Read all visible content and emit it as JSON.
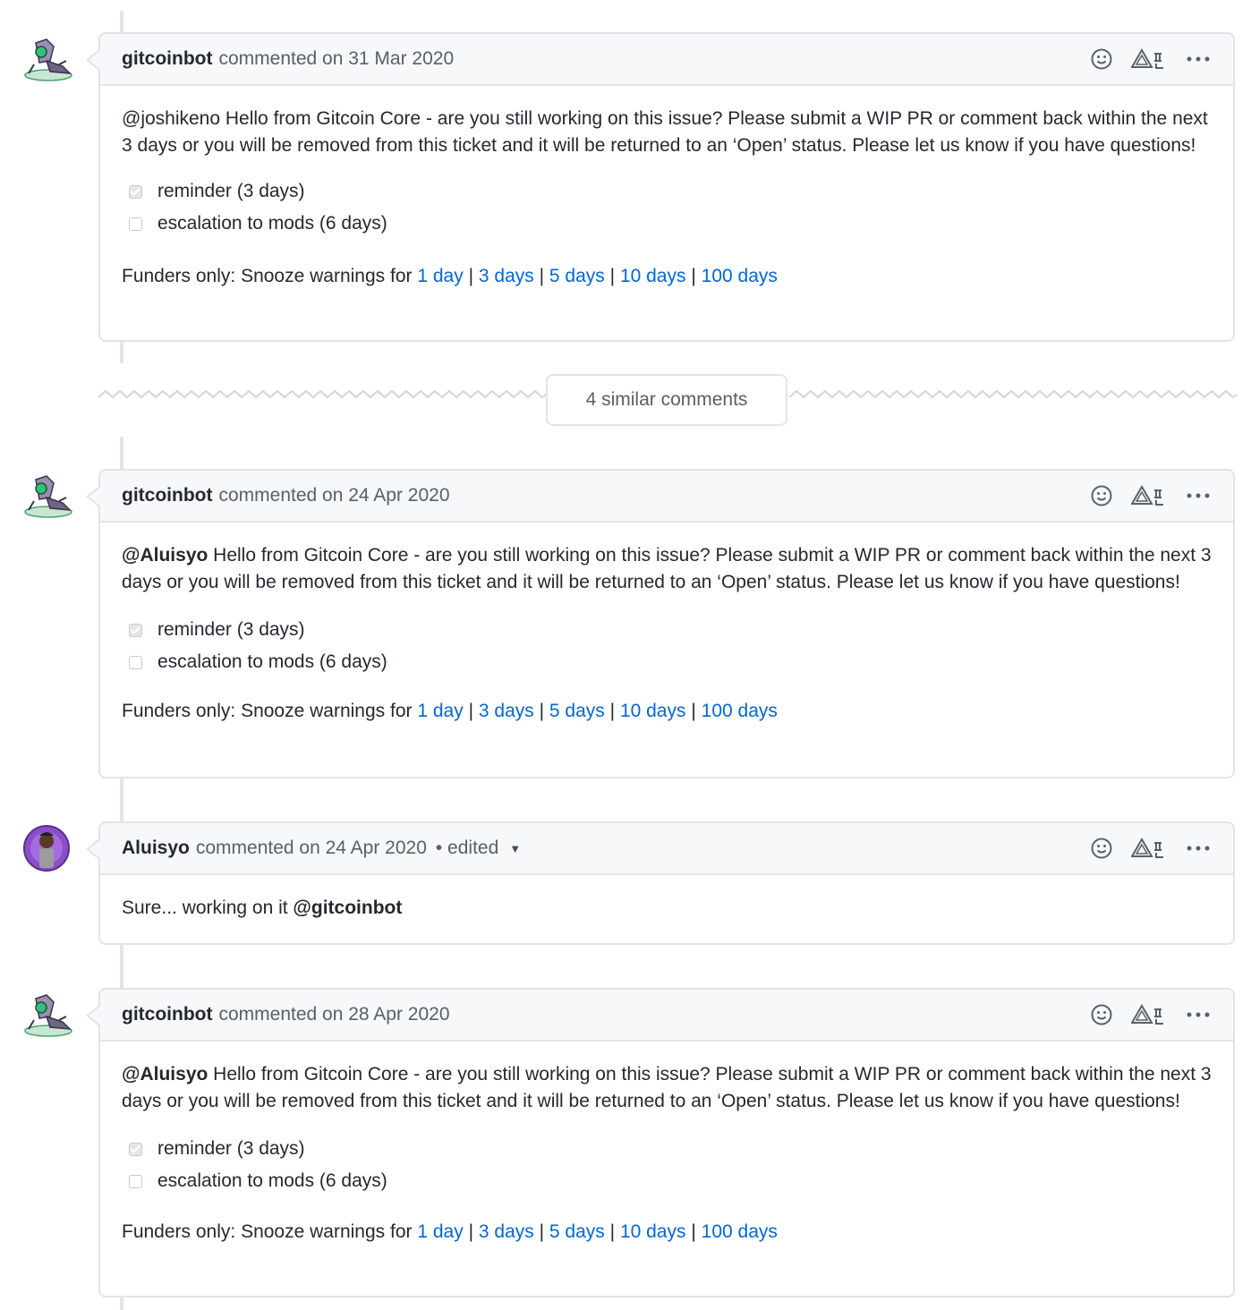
{
  "comments": [
    {
      "author": "gitcoinbot",
      "meta": "commented on 31 Mar 2020",
      "mention": "@joshikeno",
      "body": " Hello from Gitcoin Core - are you still working on this issue? Please submit a WIP PR or comment back within the next 3 days or you will be removed from this ticket and it will be returned to an ‘Open’ status. Please let us know if you have questions!",
      "checks": [
        {
          "label": "reminder (3 days)",
          "checked": true
        },
        {
          "label": "escalation to mods (6 days)",
          "checked": false
        }
      ],
      "snooze_prefix": "Funders only: Snooze warnings for ",
      "snooze_links": [
        "1 day",
        "3 days",
        "5 days",
        "10 days",
        "100 days"
      ]
    },
    {
      "author": "gitcoinbot",
      "meta": "commented on 24 Apr 2020",
      "mention": "@Aluisyo",
      "body": " Hello from Gitcoin Core - are you still working on this issue? Please submit a WIP PR or comment back within the next 3 days or you will be removed from this ticket and it will be returned to an ‘Open’ status. Please let us know if you have questions!",
      "checks": [
        {
          "label": "reminder (3 days)",
          "checked": true
        },
        {
          "label": "escalation to mods (6 days)",
          "checked": false
        }
      ],
      "snooze_prefix": "Funders only: Snooze warnings for ",
      "snooze_links": [
        "1 day",
        "3 days",
        "5 days",
        "10 days",
        "100 days"
      ]
    },
    {
      "author": "Aluisyo",
      "meta": "commented on 24 Apr 2020",
      "edited": "• edited",
      "body_text": "Sure... working on it ",
      "body_mention": "@gitcoinbot"
    },
    {
      "author": "gitcoinbot",
      "meta": "commented on 28 Apr 2020",
      "mention": "@Aluisyo",
      "body": " Hello from Gitcoin Core - are you still working on this issue? Please submit a WIP PR or comment back within the next 3 days or you will be removed from this ticket and it will be returned to an ‘Open’ status. Please let us know if you have questions!",
      "checks": [
        {
          "label": "reminder (3 days)",
          "checked": true
        },
        {
          "label": "escalation to mods (6 days)",
          "checked": false
        }
      ],
      "snooze_prefix": "Funders only: Snooze warnings for ",
      "snooze_links": [
        "1 day",
        "3 days",
        "5 days",
        "10 days",
        "100 days"
      ]
    }
  ],
  "similar_comments": "4 similar comments",
  "separator": "|",
  "icons": {
    "reaction": "smiley-icon",
    "extension": "triangle-extension-icon",
    "menu": "kebab-horizontal-icon",
    "caret": "triangle-down-icon"
  },
  "colors": {
    "link": "#0366d6",
    "border": "#e1e4e8",
    "header_bg": "#f6f8fa",
    "muted": "#586069"
  }
}
